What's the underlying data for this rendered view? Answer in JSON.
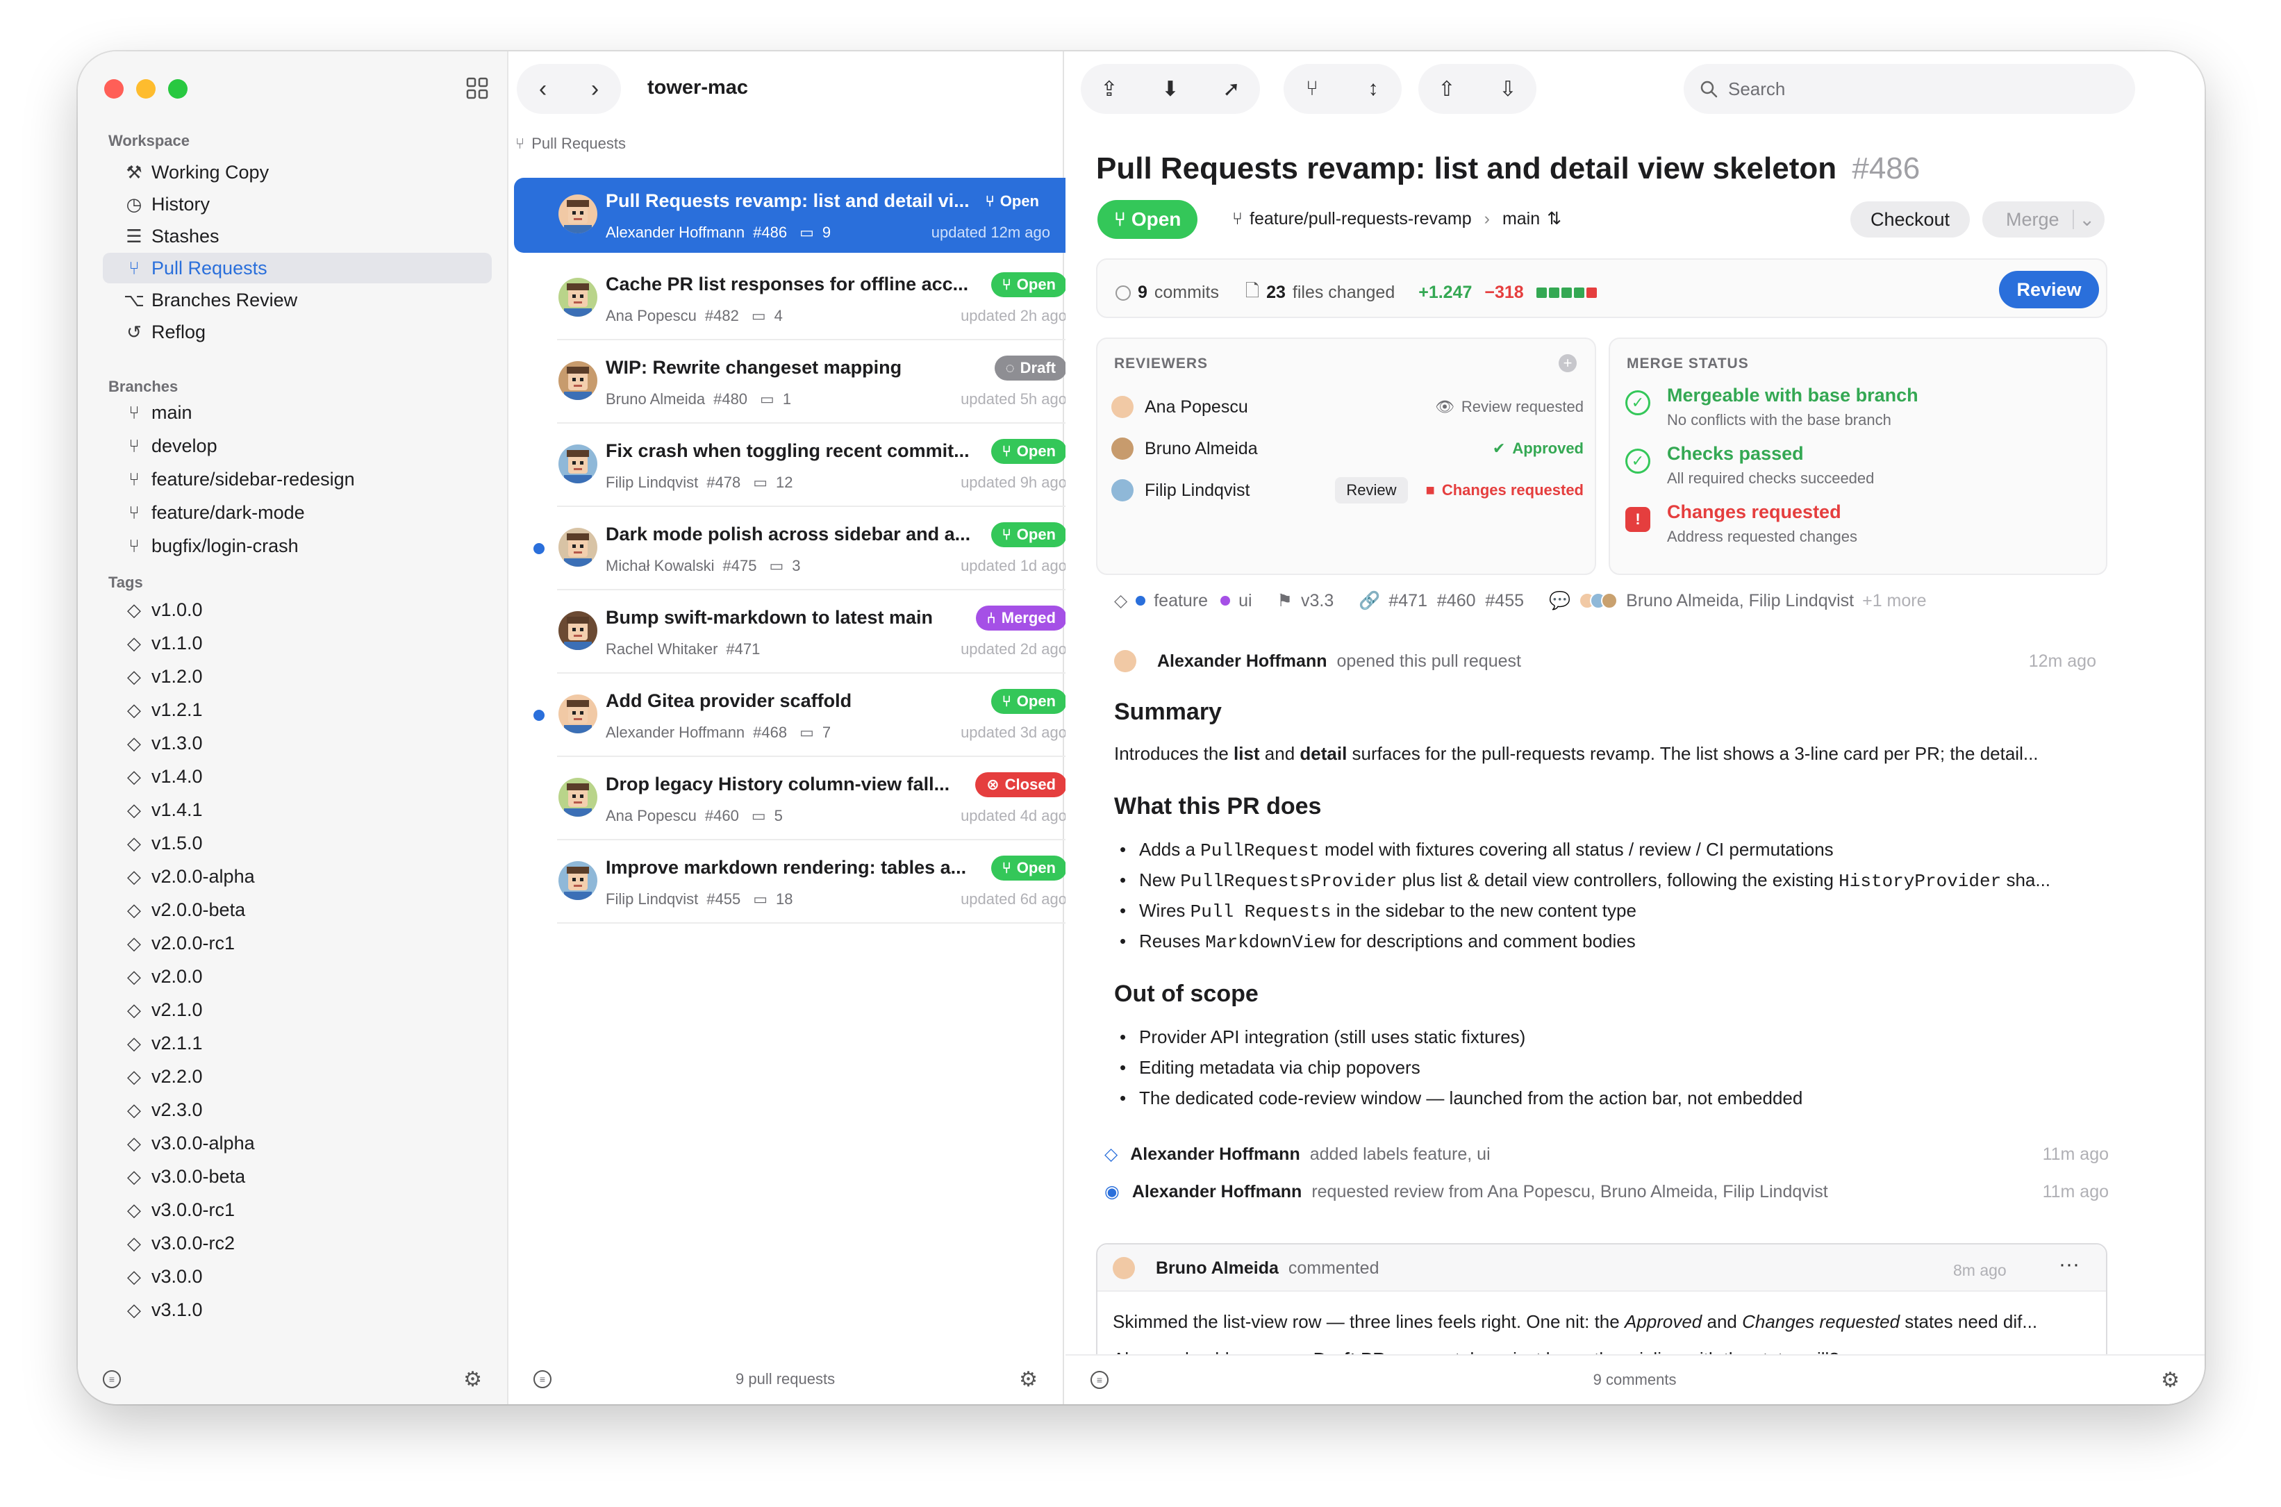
{
  "sidebar": {
    "workspace_title": "Workspace",
    "workspace_items": [
      {
        "label": "Working Copy",
        "icon": "hammer-icon"
      },
      {
        "label": "History",
        "icon": "clock-icon"
      },
      {
        "label": "Stashes",
        "icon": "tray-icon"
      },
      {
        "label": "Pull Requests",
        "icon": "pull-request-icon"
      },
      {
        "label": "Branches Review",
        "icon": "branches-review-icon"
      },
      {
        "label": "Reflog",
        "icon": "reflog-icon"
      }
    ],
    "branches_title": "Branches",
    "branches": [
      "main",
      "develop",
      "feature/sidebar-redesign",
      "feature/dark-mode",
      "bugfix/login-crash"
    ],
    "tags_title": "Tags",
    "tags": [
      "v1.0.0",
      "v1.1.0",
      "v1.2.0",
      "v1.2.1",
      "v1.3.0",
      "v1.4.0",
      "v1.4.1",
      "v1.5.0",
      "v2.0.0-alpha",
      "v2.0.0-beta",
      "v2.0.0-rc1",
      "v2.0.0",
      "v2.1.0",
      "v2.1.1",
      "v2.2.0",
      "v2.3.0",
      "v3.0.0-alpha",
      "v3.0.0-beta",
      "v3.0.0-rc1",
      "v3.0.0-rc2",
      "v3.0.0",
      "v3.1.0"
    ]
  },
  "list": {
    "repo": "tower-mac",
    "breadcrumb": "Pull Requests",
    "footer": "9 pull requests",
    "items": [
      {
        "title": "Pull Requests revamp: list and detail vi...",
        "author": "Alexander Hoffmann",
        "number": "#486",
        "comments": "9",
        "updated": "updated 12m ago",
        "status": "Open",
        "kind": "sel",
        "unread": false
      },
      {
        "title": "Cache PR list responses for offline acc...",
        "author": "Ana Popescu",
        "number": "#482",
        "comments": "4",
        "updated": "updated 2h ago",
        "status": "Open",
        "kind": "open",
        "unread": false
      },
      {
        "title": "WIP: Rewrite changeset mapping",
        "author": "Bruno Almeida",
        "number": "#480",
        "comments": "1",
        "updated": "updated 5h ago",
        "status": "Draft",
        "kind": "draft",
        "unread": false
      },
      {
        "title": "Fix crash when toggling recent commit...",
        "author": "Filip Lindqvist",
        "number": "#478",
        "comments": "12",
        "updated": "updated 9h ago",
        "status": "Open",
        "kind": "open",
        "unread": false
      },
      {
        "title": "Dark mode polish across sidebar and a...",
        "author": "Michał Kowalski",
        "number": "#475",
        "comments": "3",
        "updated": "updated 1d ago",
        "status": "Open",
        "kind": "open",
        "unread": true
      },
      {
        "title": "Bump swift-markdown to latest main",
        "author": "Rachel Whitaker",
        "number": "#471",
        "comments": "",
        "updated": "updated 2d ago",
        "status": "Merged",
        "kind": "merged",
        "unread": false
      },
      {
        "title": "Add Gitea provider scaffold",
        "author": "Alexander Hoffmann",
        "number": "#468",
        "comments": "7",
        "updated": "updated 3d ago",
        "status": "Open",
        "kind": "open",
        "unread": true
      },
      {
        "title": "Drop legacy History column-view fall...",
        "author": "Ana Popescu",
        "number": "#460",
        "comments": "5",
        "updated": "updated 4d ago",
        "status": "Closed",
        "kind": "closed",
        "unread": false
      },
      {
        "title": "Improve markdown rendering: tables a...",
        "author": "Filip Lindqvist",
        "number": "#455",
        "comments": "18",
        "updated": "updated 6d ago",
        "status": "Open",
        "kind": "open",
        "unread": false
      }
    ]
  },
  "detail": {
    "search_placeholder": "Search",
    "title": "Pull Requests revamp: list and detail view skeleton",
    "number": "#486",
    "status": "Open",
    "branch": "feature/pull-requests-revamp",
    "base": "main",
    "checkout": "Checkout",
    "merge": "Merge",
    "commits_n": "9",
    "commits_label": "commits",
    "files_n": "23",
    "files_label": "files changed",
    "additions": "+1.247",
    "deletions": "−318",
    "review_button": "Review",
    "reviewers_title": "REVIEWERS",
    "reviewers": [
      {
        "name": "Ana Popescu",
        "state": "Review requested",
        "kind": "requested"
      },
      {
        "name": "Bruno Almeida",
        "state": "Approved",
        "kind": "approved"
      },
      {
        "name": "Filip Lindqvist",
        "state": "Changes requested",
        "kind": "changes",
        "action": "Review"
      }
    ],
    "merge_title": "MERGE STATUS",
    "merge_items": [
      {
        "title": "Mergeable with base branch",
        "sub": "No conflicts with the base branch",
        "kind": "ok"
      },
      {
        "title": "Checks passed",
        "sub": "All required checks succeeded",
        "kind": "ok"
      },
      {
        "title": "Changes requested",
        "sub": "Address requested changes",
        "kind": "bad"
      }
    ],
    "meta": {
      "labels": [
        "feature",
        "ui"
      ],
      "milestone": "v3.3",
      "links": "#471  #460  #455",
      "participants": "Bruno Almeida, Filip Lindqvist",
      "more": "+1 more"
    },
    "opened": {
      "author": "Alexander Hoffmann",
      "action": "opened this pull request",
      "time": "12m ago"
    },
    "summary_h": "Summary",
    "summary_p1": "Introduces the ",
    "summary_b1": "list",
    "summary_p2": " and ",
    "summary_b2": "detail",
    "summary_p3": " surfaces for the pull-requests revamp. The list shows a 3-line card per PR; the detail...",
    "does_h": "What this PR does",
    "does": [
      {
        "a": "Adds a ",
        "code": "PullRequest",
        "b": " model with fixtures covering all status / review / CI permutations"
      },
      {
        "a": "New ",
        "code": "PullRequestsProvider",
        "b": " plus list & detail view controllers, following the existing ",
        "code2": "HistoryProvider",
        "c": " sha..."
      },
      {
        "a": "Wires ",
        "code": "Pull Requests",
        "b": " in the sidebar to the new content type"
      },
      {
        "a": "Reuses ",
        "code": "MarkdownView",
        "b": " for descriptions and comment bodies"
      }
    ],
    "scope_h": "Out of scope",
    "scope": [
      "Provider API integration (still uses static fixtures)",
      "Editing metadata via chip popovers",
      "The dedicated code-review window — launched from the action bar, not embedded"
    ],
    "events": [
      {
        "author": "Alexander Hoffmann",
        "text": "added labels feature, ui",
        "time": "11m ago"
      },
      {
        "author": "Alexander Hoffmann",
        "text": "requested review from Ana Popescu, Bruno Almeida, Filip Lindqvist",
        "time": "11m ago"
      }
    ],
    "comment": {
      "author": "Bruno Almeida",
      "action": "commented",
      "time": "8m ago",
      "l1a": "Skimmed the list-view row — three lines feels right. One nit: the ",
      "l1i1": "Approved",
      "l1b": " and ",
      "l1i2": "Changes requested",
      "l1c": " states need dif...",
      "l2a": "Also — should we group ",
      "l2b": "Draft",
      "l2c": " PRs separately, or just leave them inline with the status pill?"
    },
    "footer": "9 comments"
  }
}
